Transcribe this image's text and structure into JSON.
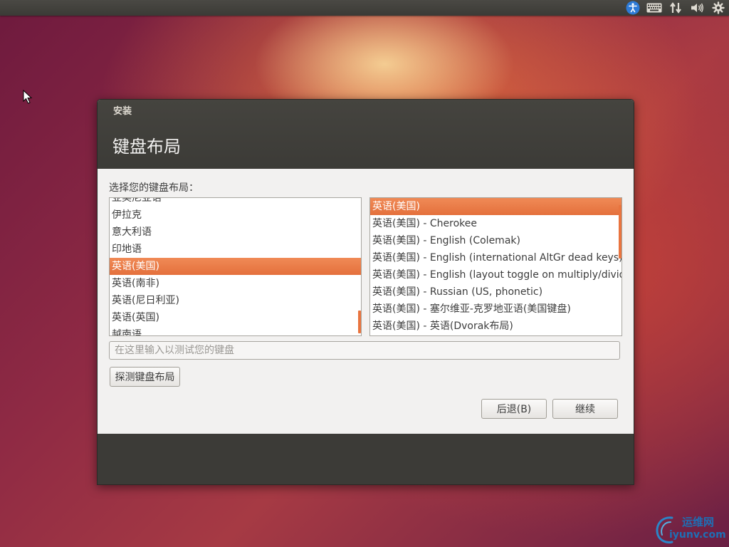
{
  "colors": {
    "accent": "#e4703c",
    "panel": "#3c3b37",
    "window_bg": "#f2f1f0"
  },
  "top_panel": {
    "icons": [
      "accessibility-icon",
      "keyboard-icon",
      "network-icon",
      "volume-icon",
      "settings-gear-icon"
    ]
  },
  "window": {
    "title": "安装",
    "heading": "键盘布局"
  },
  "prompt": "选择您的键盘布局：",
  "layouts": {
    "items": [
      "亚美尼亚语",
      "伊拉克",
      "意大利语",
      "印地语",
      "英语(美国)",
      "英语(南非)",
      "英语(尼日利亚)",
      "英语(英国)",
      "越南语"
    ],
    "selected": "英语(美国)"
  },
  "variants": {
    "items": [
      "英语(美国)",
      "英语(美国) - Cherokee",
      "英语(美国) - English (Colemak)",
      "英语(美国) - English (international AltGr dead keys)",
      "英语(美国) - English (layout toggle on multiply/divide",
      "英语(美国) - Russian (US, phonetic)",
      "英语(美国) - 塞尔维亚-克罗地亚语(美国键盘)",
      "英语(美国) - 英语(Dvorak布局)"
    ],
    "selected": "英语(美国)"
  },
  "test_input": {
    "placeholder": "在这里输入以测试您的键盘",
    "value": ""
  },
  "buttons": {
    "detect": "探测键盘布局",
    "back": "后退(B)",
    "continue": "继续"
  },
  "watermark": {
    "cn": "运维网",
    "en": "iyunv.com"
  }
}
